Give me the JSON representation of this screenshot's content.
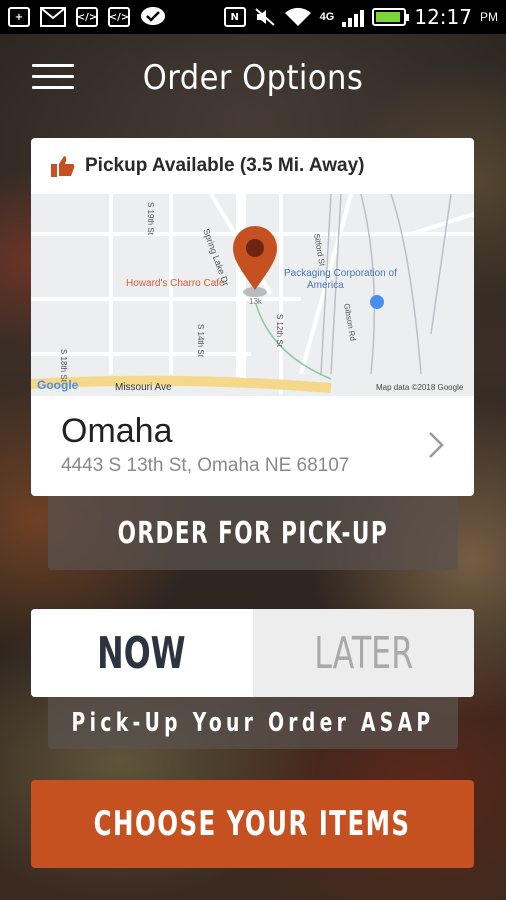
{
  "status_bar": {
    "time": "12:17",
    "ampm": "PM",
    "network": "4G",
    "icons": [
      "plus-box-icon",
      "gmail-icon",
      "code-icon",
      "code-icon",
      "chat-icon",
      "nfc-icon",
      "mute-icon",
      "wifi-icon",
      "signal-icon",
      "battery-icon"
    ]
  },
  "header": {
    "title": "Order Options"
  },
  "location_card": {
    "availability": "Pickup Available (3.5 Mi. Away)",
    "map": {
      "place_1": "Howard's Charro Cafe",
      "place_2": "Packaging Corporation of America",
      "street_missouri": "Missouri Ave",
      "street_spring_lake": "Spring Lake Dr",
      "street_s19": "S 19th St",
      "street_s14": "S 14th St",
      "street_s12": "S 12th St",
      "street_s18": "S 18th St",
      "street_gibson": "Gibson Rd",
      "street_sitford": "Sitford St",
      "street_l3k": "13k",
      "brand": "Google",
      "attribution": "Map data ©2018 Google"
    },
    "city": "Omaha",
    "address": "4443 S 13th St, Omaha NE 68107"
  },
  "order_pickup_label": "ORDER FOR PICK-UP",
  "timing": {
    "now": "NOW",
    "later": "LATER",
    "selected": "NOW"
  },
  "timing_caption": "Pick-Up Your Order ASAP",
  "cta_label": "CHOOSE YOUR ITEMS",
  "colors": {
    "accent": "#c4511f",
    "pin": "#c4511f",
    "thumb": "#c4511f"
  }
}
